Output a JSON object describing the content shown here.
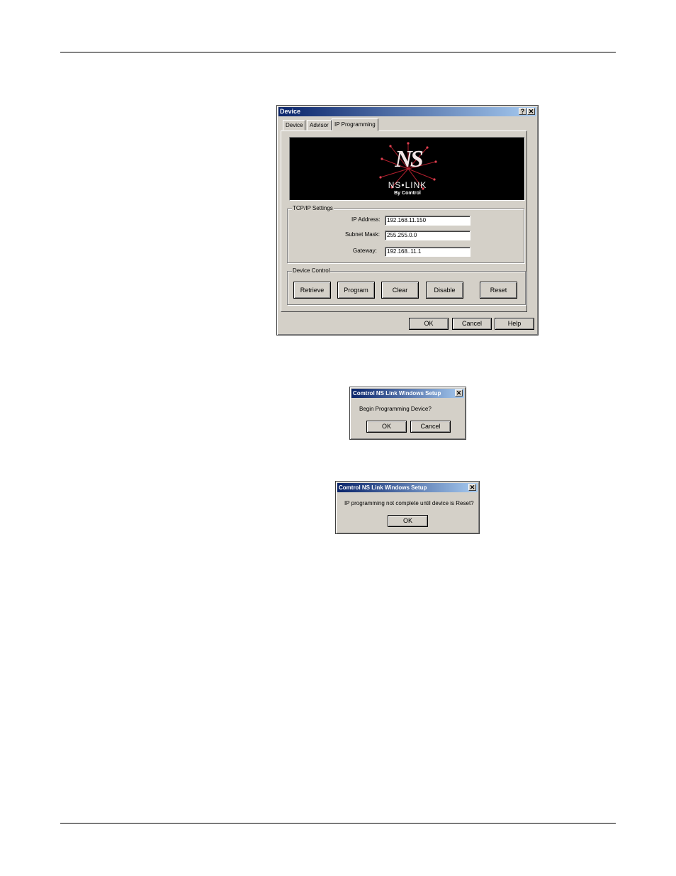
{
  "device_dialog": {
    "title": "Device",
    "help_glyph": "?",
    "close_glyph": "✕",
    "tabs": [
      {
        "label": "Device"
      },
      {
        "label": "Advisor"
      },
      {
        "label": "IP Programming"
      }
    ],
    "logo": {
      "primary": "NS",
      "brand": "NS•LINK",
      "byline": "By Comtrol"
    },
    "tcpip": {
      "caption": "TCP/IP  Settings",
      "ip_label": "IP Address:",
      "ip_value": "192.168.11.150",
      "mask_label": "Subnet Mask:",
      "mask_value": "255.255.0.0",
      "gateway_label": "Gateway:",
      "gateway_value": "192.168..11.1"
    },
    "device_control": {
      "caption": "Device Control",
      "buttons": [
        "Retrieve",
        "Program",
        "Clear",
        "Disable",
        "Reset"
      ]
    },
    "footer_buttons": [
      "OK",
      "Cancel",
      "Help"
    ]
  },
  "confirm_dialog": {
    "title": "Comtrol NS Link Windows Setup",
    "close_glyph": "✕",
    "message": "Begin Programming Device?",
    "ok": "OK",
    "cancel": "Cancel"
  },
  "notice_dialog": {
    "title": "Comtrol NS Link Windows Setup",
    "close_glyph": "✕",
    "message": "IP programming not complete until device is Reset?",
    "ok": "OK"
  }
}
